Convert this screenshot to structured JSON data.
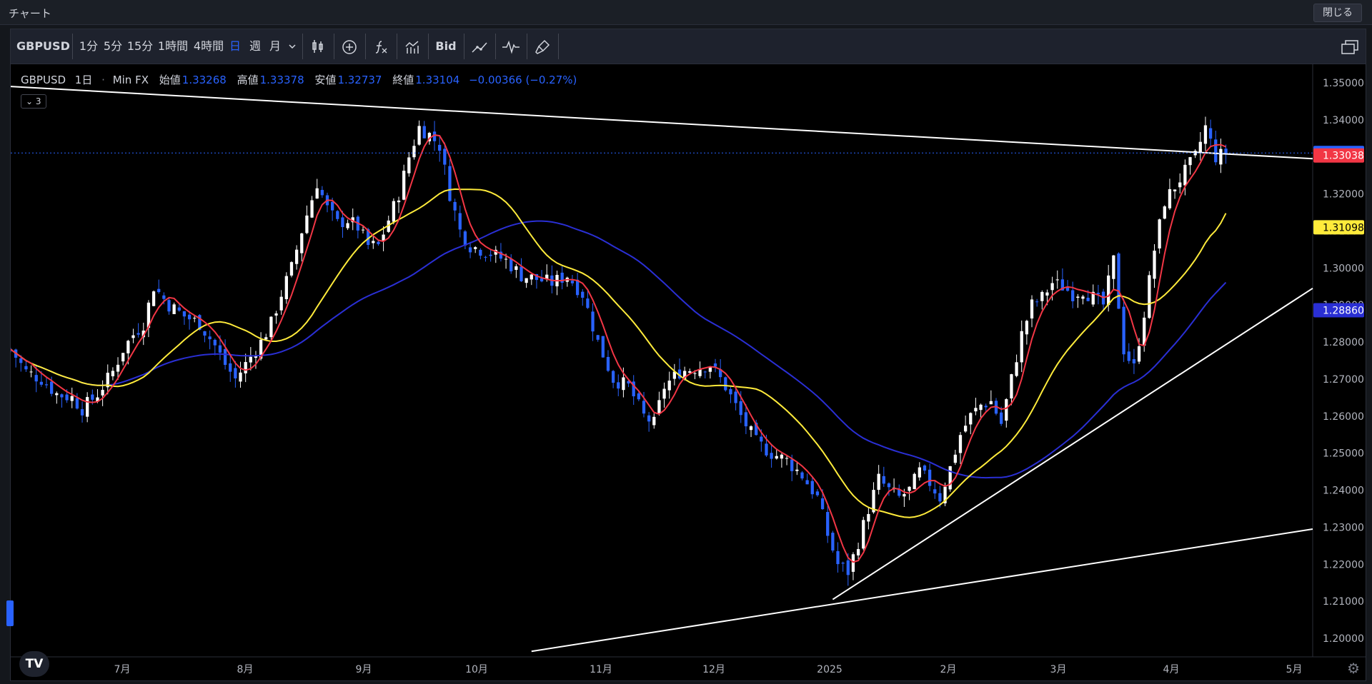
{
  "window": {
    "title": "チャート",
    "close_label": "閉じる"
  },
  "toolbar": {
    "symbol": "GBPUSD",
    "intervals": [
      "1分",
      "5分",
      "15分",
      "1時間",
      "4時間",
      "日",
      "週",
      "月"
    ],
    "active_interval": "日",
    "bid_label": "Bid",
    "icons": [
      "candles-icon",
      "add-indicator-icon",
      "function-icon",
      "compare-icon",
      "trend-icon",
      "wave-icon",
      "brush-icon",
      "windows-icon"
    ]
  },
  "legend": {
    "symbol": "GBPUSD",
    "interval": "1日",
    "source": "Min FX",
    "open_label": "始値",
    "open": "1.33268",
    "high_label": "高値",
    "high": "1.33378",
    "low_label": "安値",
    "low": "1.32737",
    "close_label": "終値",
    "close": "1.33104",
    "change": "−0.00366 (−0.27%)",
    "indicator_count": "3"
  },
  "colors": {
    "up": "#ffffff",
    "down": "#2962ff",
    "ma_fast": "#f23645",
    "ma_mid": "#ffeb3b",
    "ma_slow": "#2a2fd4",
    "trendline": "#ffffff"
  },
  "logo_text": "TV",
  "chart_data": {
    "type": "candlestick",
    "symbol": "GBPUSD",
    "interval": "1日",
    "ylim": [
      1.195,
      1.355
    ],
    "y_ticks": [
      "1.35000",
      "1.34000",
      "1.33000",
      "1.32000",
      "1.31000",
      "1.30000",
      "1.29000",
      "1.28000",
      "1.27000",
      "1.26000",
      "1.25000",
      "1.24000",
      "1.23000",
      "1.22000",
      "1.21000",
      "1.20000"
    ],
    "x_ticks": [
      "7月",
      "8月",
      "9月",
      "10月",
      "11月",
      "12月",
      "2025",
      "2月",
      "3月",
      "4月",
      "5月"
    ],
    "price_labels": [
      {
        "value": 1.33104,
        "text": "1.33104",
        "bg": "#2962ff",
        "fg": "#ffffff"
      },
      {
        "value": 1.33038,
        "text": "1.33038",
        "bg": "#f23645",
        "fg": "#ffffff"
      },
      {
        "value": 1.31098,
        "text": "1.31098",
        "bg": "#ffeb3b",
        "fg": "#000000"
      },
      {
        "value": 1.2886,
        "text": "1.28860",
        "bg": "#2a2fd4",
        "fg": "#ffffff"
      }
    ],
    "close_path": [
      [
        0,
        1.278
      ],
      [
        3,
        1.272
      ],
      [
        6,
        1.27
      ],
      [
        9,
        1.266
      ],
      [
        12,
        1.265
      ],
      [
        14,
        1.262
      ],
      [
        17,
        1.266
      ],
      [
        20,
        1.272
      ],
      [
        22,
        1.278
      ],
      [
        24,
        1.282
      ],
      [
        26,
        1.285
      ],
      [
        28,
        1.295
      ],
      [
        31,
        1.29
      ],
      [
        34,
        1.287
      ],
      [
        37,
        1.285
      ],
      [
        40,
        1.279
      ],
      [
        42,
        1.274
      ],
      [
        44,
        1.27
      ],
      [
        47,
        1.276
      ],
      [
        49,
        1.28
      ],
      [
        51,
        1.285
      ],
      [
        53,
        1.293
      ],
      [
        55,
        1.3
      ],
      [
        57,
        1.31
      ],
      [
        60,
        1.323
      ],
      [
        62,
        1.316
      ],
      [
        64,
        1.312
      ],
      [
        66,
        1.313
      ],
      [
        68,
        1.311
      ],
      [
        70,
        1.306
      ],
      [
        72,
        1.306
      ],
      [
        74,
        1.313
      ],
      [
        76,
        1.32
      ],
      [
        78,
        1.33
      ],
      [
        80,
        1.338
      ],
      [
        82,
        1.336
      ],
      [
        84,
        1.333
      ],
      [
        86,
        1.32
      ],
      [
        88,
        1.31
      ],
      [
        90,
        1.306
      ],
      [
        92,
        1.305
      ],
      [
        94,
        1.304
      ],
      [
        97,
        1.302
      ],
      [
        100,
        1.298
      ],
      [
        103,
        1.297
      ],
      [
        106,
        1.296
      ],
      [
        109,
        1.298
      ],
      [
        112,
        1.293
      ],
      [
        115,
        1.28
      ],
      [
        118,
        1.27
      ],
      [
        121,
        1.268
      ],
      [
        124,
        1.26
      ],
      [
        126,
        1.258
      ],
      [
        128,
        1.268
      ],
      [
        131,
        1.272
      ],
      [
        134,
        1.273
      ],
      [
        137,
        1.274
      ],
      [
        140,
        1.268
      ],
      [
        143,
        1.26
      ],
      [
        146,
        1.253
      ],
      [
        149,
        1.25
      ],
      [
        152,
        1.248
      ],
      [
        155,
        1.244
      ],
      [
        158,
        1.238
      ],
      [
        160,
        1.228
      ],
      [
        162,
        1.22
      ],
      [
        164,
        1.218
      ],
      [
        166,
        1.226
      ],
      [
        168,
        1.235
      ],
      [
        170,
        1.243
      ],
      [
        172,
        1.24
      ],
      [
        174,
        1.238
      ],
      [
        176,
        1.24
      ],
      [
        178,
        1.245
      ],
      [
        180,
        1.242
      ],
      [
        182,
        1.238
      ],
      [
        184,
        1.246
      ],
      [
        186,
        1.255
      ],
      [
        188,
        1.26
      ],
      [
        190,
        1.263
      ],
      [
        192,
        1.264
      ],
      [
        194,
        1.258
      ],
      [
        196,
        1.27
      ],
      [
        198,
        1.282
      ],
      [
        200,
        1.29
      ],
      [
        202,
        1.292
      ],
      [
        204,
        1.296
      ],
      [
        206,
        1.295
      ],
      [
        208,
        1.293
      ],
      [
        210,
        1.294
      ],
      [
        212,
        1.292
      ],
      [
        214,
        1.29
      ],
      [
        216,
        1.302
      ],
      [
        218,
        1.278
      ],
      [
        220,
        1.273
      ],
      [
        222,
        1.288
      ],
      [
        224,
        1.305
      ],
      [
        226,
        1.318
      ],
      [
        228,
        1.322
      ],
      [
        230,
        1.326
      ],
      [
        232,
        1.33
      ],
      [
        234,
        1.338
      ],
      [
        236,
        1.33
      ],
      [
        238,
        1.331
      ]
    ],
    "trendlines": [
      {
        "from": [
          0,
          1.349
        ],
        "to": [
          255,
          1.3295
        ]
      },
      {
        "from": [
          161,
          1.2105
        ],
        "to": [
          255,
          1.2945
        ]
      },
      {
        "from": [
          102,
          1.1965
        ],
        "to": [
          255,
          1.2295
        ]
      }
    ]
  }
}
